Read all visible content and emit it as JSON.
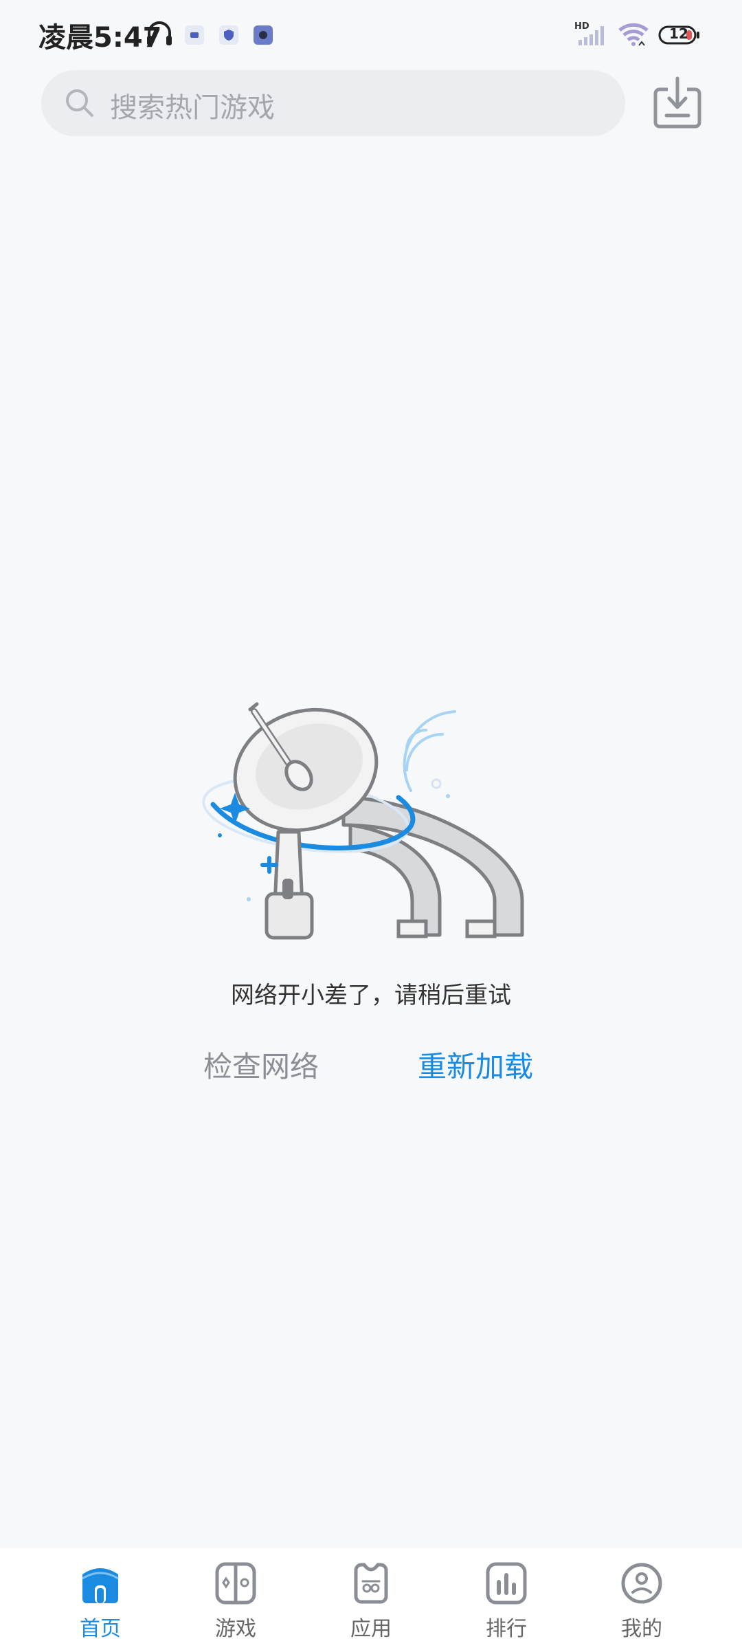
{
  "status_bar": {
    "time": "凌晨5:47",
    "battery_level": "12",
    "network_label": "HD"
  },
  "search": {
    "placeholder": "搜索热门游戏"
  },
  "empty_state": {
    "message": "网络开小差了，请稍后重试",
    "check_network_label": "检查网络",
    "reload_label": "重新加载"
  },
  "bottom_nav": {
    "items": [
      {
        "label": "首页",
        "icon": "home-icon",
        "active": true
      },
      {
        "label": "游戏",
        "icon": "gamepad-icon",
        "active": false
      },
      {
        "label": "应用",
        "icon": "apps-icon",
        "active": false
      },
      {
        "label": "排行",
        "icon": "ranking-icon",
        "active": false
      },
      {
        "label": "我的",
        "icon": "profile-icon",
        "active": false
      }
    ]
  },
  "colors": {
    "accent": "#1a8be0",
    "background": "#f7f8fa",
    "search_bg": "#ebedf0"
  }
}
